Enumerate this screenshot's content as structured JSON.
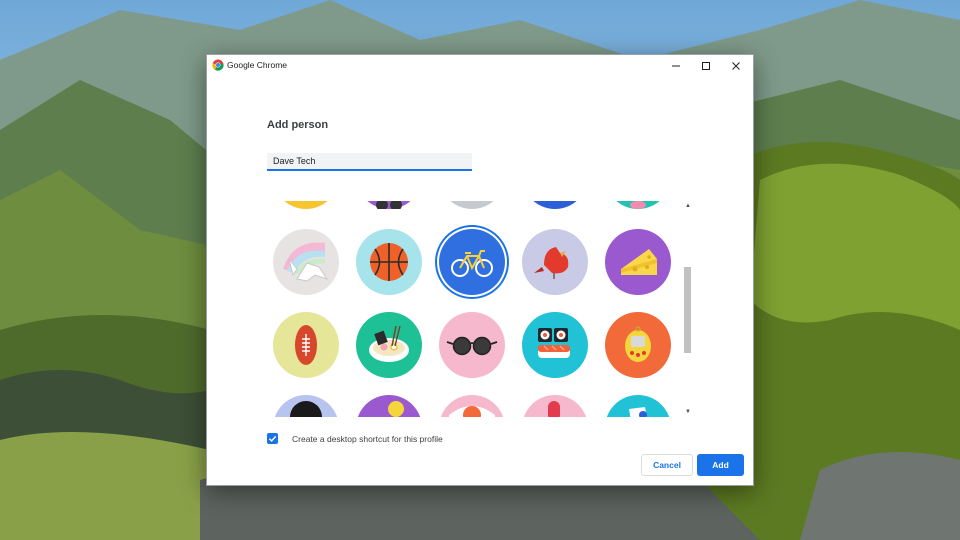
{
  "window": {
    "title": "Google Chrome",
    "icon": "chrome-logo-icon",
    "controls": {
      "minimize": "minimize-icon",
      "maximize": "maximize-icon",
      "close": "close-icon"
    }
  },
  "dialog": {
    "heading": "Add person",
    "name_input_value": "Dave Tech",
    "shortcut_label": "Create a desktop shortcut for this profile",
    "shortcut_checked": true,
    "cancel_label": "Cancel",
    "add_label": "Add"
  },
  "avatars": {
    "selected": "bicycle",
    "partial_top_row": [
      "yellow",
      "purple-sunglasses",
      "grey",
      "blue",
      "teal-pink"
    ],
    "row_1": [
      "origami-unicorn",
      "basketball",
      "bicycle",
      "cardinal-bird",
      "cheese"
    ],
    "row_2": [
      "football",
      "ramen-bowl",
      "sunglasses",
      "sushi",
      "tamagotchi"
    ],
    "partial_bottom_row": [
      "dark-ball",
      "purple-yellow",
      "white-orange",
      "pink-red",
      "blue-white"
    ]
  },
  "colors": {
    "accent": "#1a73e8",
    "avatar_bg_selected": "#2f6fe0"
  }
}
